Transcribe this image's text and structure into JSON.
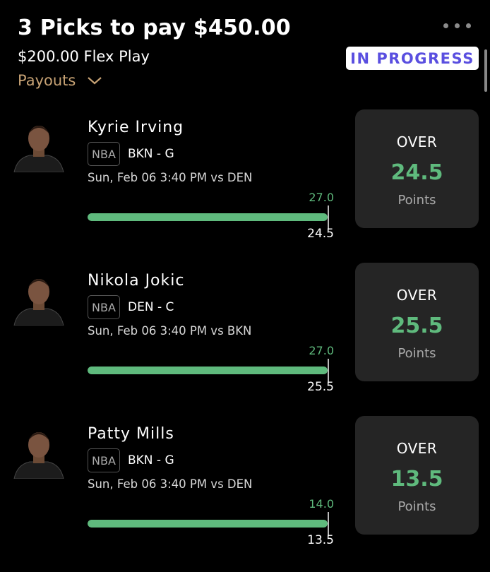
{
  "header": {
    "title": "3 Picks to pay $450.00",
    "subtitle": "$200.00 Flex Play",
    "status": "IN PROGRESS",
    "payouts_label": "Payouts",
    "status_color": "#5a4fe0",
    "payouts_color": "#c7a274"
  },
  "accent_color": "#5fba7d",
  "picks": [
    {
      "player": "Kyrie Irving",
      "league": "NBA",
      "team_pos": "BKN - G",
      "game": "Sun, Feb 06 3:40 PM vs DEN",
      "current": "27.0",
      "line": "24.5",
      "progress": 1.0,
      "direction": "OVER",
      "stat": "Points",
      "avatar_icon": "player-headshot-icon"
    },
    {
      "player": "Nikola Jokic",
      "league": "NBA",
      "team_pos": "DEN - C",
      "game": "Sun, Feb 06 3:40 PM vs BKN",
      "current": "27.0",
      "line": "25.5",
      "progress": 1.0,
      "direction": "OVER",
      "stat": "Points",
      "avatar_icon": "player-headshot-icon"
    },
    {
      "player": "Patty Mills",
      "league": "NBA",
      "team_pos": "BKN - G",
      "game": "Sun, Feb 06 3:40 PM vs DEN",
      "current": "14.0",
      "line": "13.5",
      "progress": 1.0,
      "direction": "OVER",
      "stat": "Points",
      "avatar_icon": "player-headshot-icon"
    }
  ]
}
